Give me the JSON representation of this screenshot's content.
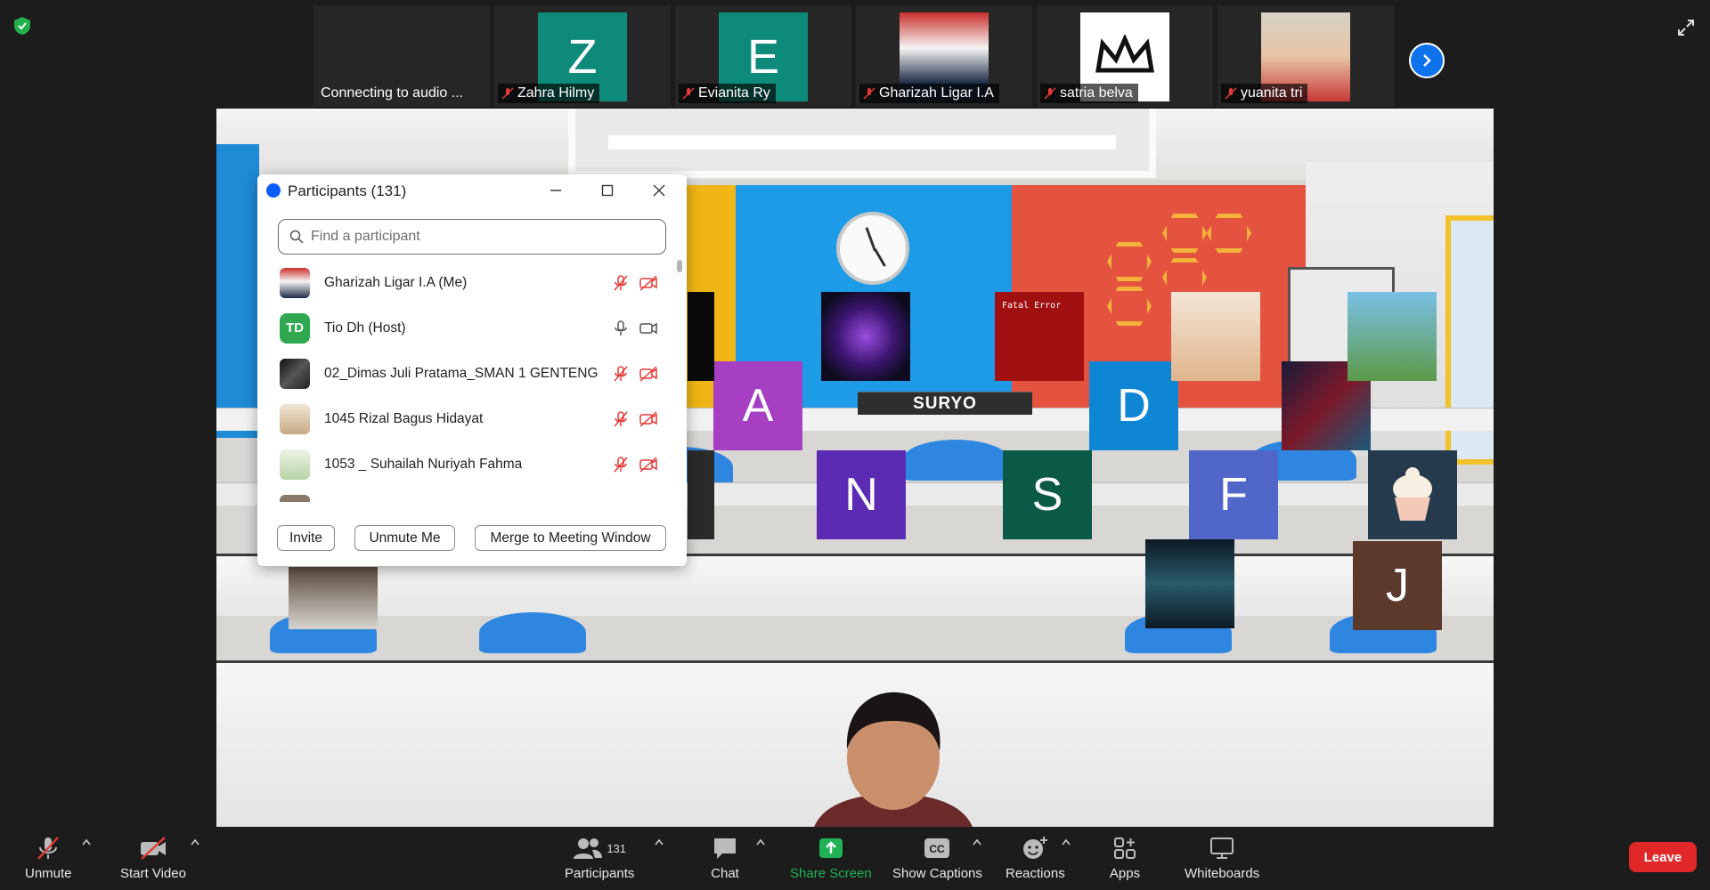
{
  "top_strip": {
    "thumbnails": [
      {
        "name": "Connecting to audio ...",
        "initial": "",
        "tile_color": "#262626",
        "muted": false
      },
      {
        "name": "Zahra Hilmy",
        "initial": "Z",
        "tile_color": "#0e8a7b",
        "muted": true
      },
      {
        "name": "Evianita Ry",
        "initial": "E",
        "tile_color": "#0e8a7b",
        "muted": true
      },
      {
        "name": "Gharizah Ligar I.A",
        "initial": "",
        "tile_color": "#c9302c",
        "muted": true
      },
      {
        "name": "satria belva",
        "initial": "",
        "tile_color": "#ffffff",
        "muted": true
      },
      {
        "name": "yuanita tri",
        "initial": "",
        "tile_color": "#d7d2c8",
        "muted": true
      }
    ]
  },
  "main_video": {
    "tiles": [
      {
        "initial": "A",
        "color": "#a63fc2"
      },
      {
        "initial": "N",
        "color": "#5b2bb3"
      },
      {
        "initial": "S",
        "color": "#0b5a45"
      },
      {
        "initial": "D",
        "color": "#0e86d4"
      },
      {
        "initial": "F",
        "color": "#5166c9"
      },
      {
        "initial": "J",
        "color": "#5b3a2c"
      }
    ],
    "nameplate": "SURYO",
    "fatal_error_title": "Fatal Error"
  },
  "participants_panel": {
    "title": "Participants (131)",
    "search_placeholder": "Find a participant",
    "participants": [
      {
        "name": "Gharizah Ligar I.A (Me)",
        "avatar_initials": "",
        "avatar_color": "#c9302c",
        "audio": "muted",
        "video": "off"
      },
      {
        "name": "Tio Dh (Host)",
        "avatar_initials": "TD",
        "avatar_color": "#2fa84f",
        "audio": "on",
        "video": "on"
      },
      {
        "name": "02_Dimas Juli Pratama_SMAN 1 GENTENG",
        "avatar_initials": "",
        "avatar_color": "#2c2c2c",
        "audio": "muted",
        "video": "off"
      },
      {
        "name": "1045 Rizal Bagus Hidayat",
        "avatar_initials": "",
        "avatar_color": "#c8b38f",
        "audio": "muted",
        "video": "off"
      },
      {
        "name": "1053 _ Suhailah Nuriyah Fahma",
        "avatar_initials": "",
        "avatar_color": "#b8d3a8",
        "audio": "muted",
        "video": "off"
      }
    ],
    "buttons": {
      "invite": "Invite",
      "unmute_me": "Unmute Me",
      "merge": "Merge to Meeting Window"
    }
  },
  "toolbar": {
    "unmute": "Unmute",
    "start_video": "Start Video",
    "participants": "Participants",
    "participants_count": "131",
    "chat": "Chat",
    "share_screen": "Share Screen",
    "show_captions": "Show Captions",
    "reactions": "Reactions",
    "apps": "Apps",
    "whiteboards": "Whiteboards",
    "leave": "Leave",
    "share_color": "#1fb254",
    "leave_color": "#e02828"
  }
}
